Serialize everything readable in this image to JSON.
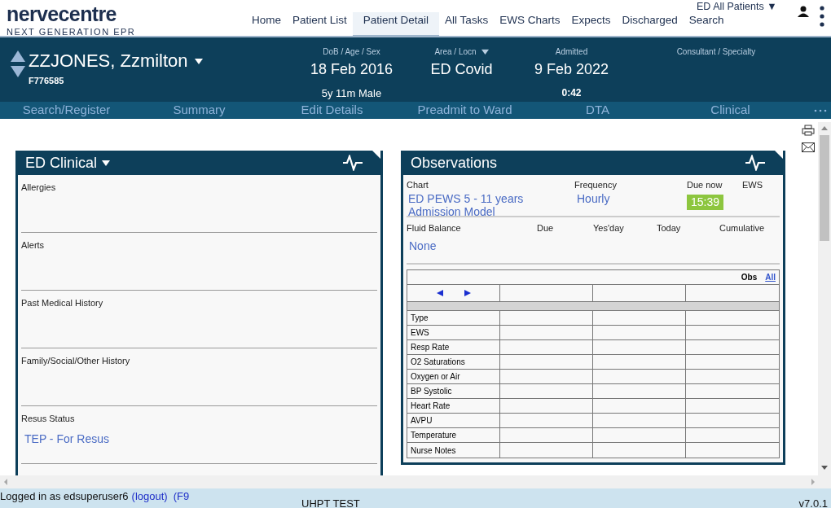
{
  "logo": {
    "name": "nervecentre",
    "tagline": "NEXT GENERATION EPR"
  },
  "nav": [
    {
      "label": "Home",
      "selected": false
    },
    {
      "label": "Patient List",
      "selected": false
    },
    {
      "label": "Patient Detail",
      "selected": true
    },
    {
      "label": "All Tasks",
      "selected": false
    },
    {
      "label": "EWS Charts",
      "selected": false
    },
    {
      "label": "Expects",
      "selected": false
    },
    {
      "label": "Discharged",
      "selected": false
    },
    {
      "label": "Search",
      "selected": false
    }
  ],
  "patient_list_selector": "ED All Patients ▼",
  "patient": {
    "name": "ZZJONES, Zzmilton",
    "id": "F776585",
    "fields": [
      {
        "label": "DoB / Age / Sex",
        "value": "18 Feb 2016",
        "sub": "5y 11m Male",
        "dropdown": false
      },
      {
        "label": "Area / Locn",
        "value": "ED Covid",
        "dropdown": true
      },
      {
        "label": "Admitted",
        "value": "9 Feb 2022",
        "sub": "0:42",
        "dropdown": false
      },
      {
        "label": "Consultant / Specialty",
        "dropdown": false
      }
    ]
  },
  "actions": [
    "Search/Register",
    "Summary",
    "Edit Details",
    "Preadmit to Ward",
    "DTA",
    "Clinical"
  ],
  "clinical_panel": {
    "title": "ED Clinical",
    "sections": [
      {
        "label": "Allergies"
      },
      {
        "label": "Alerts"
      },
      {
        "label": "Past Medical History"
      },
      {
        "label": "Family/Social/Other History"
      },
      {
        "label": "Resus Status",
        "value": "TEP - For Resus"
      }
    ]
  },
  "observations_panel": {
    "title": "Observations",
    "chart": {
      "label": "Chart",
      "value": "ED PEWS 5 - 11 years Admission Model"
    },
    "frequency": {
      "label": "Frequency",
      "value": "Hourly"
    },
    "due_now": {
      "label": "Due now",
      "value": "15:39"
    },
    "ews": {
      "label": "EWS"
    },
    "fluid_balance": {
      "label": "Fluid Balance",
      "value": "None",
      "columns": [
        "Due",
        "Yes'day",
        "Today",
        "Cumulative"
      ]
    },
    "table": {
      "obs_label": "Obs",
      "all_link": "All",
      "rows": [
        "Type",
        "EWS",
        "Resp Rate",
        "O2 Saturations",
        "Oxygen or Air",
        "BP Systolic",
        "Heart Rate",
        "AVPU",
        "Temperature",
        "Nurse Notes"
      ]
    }
  },
  "status_bar": {
    "login": "Logged in as edsuperuser6",
    "logout": "(logout)",
    "lock": "(F9",
    "environment": "UHPT TEST",
    "version": "v7.0.1"
  }
}
